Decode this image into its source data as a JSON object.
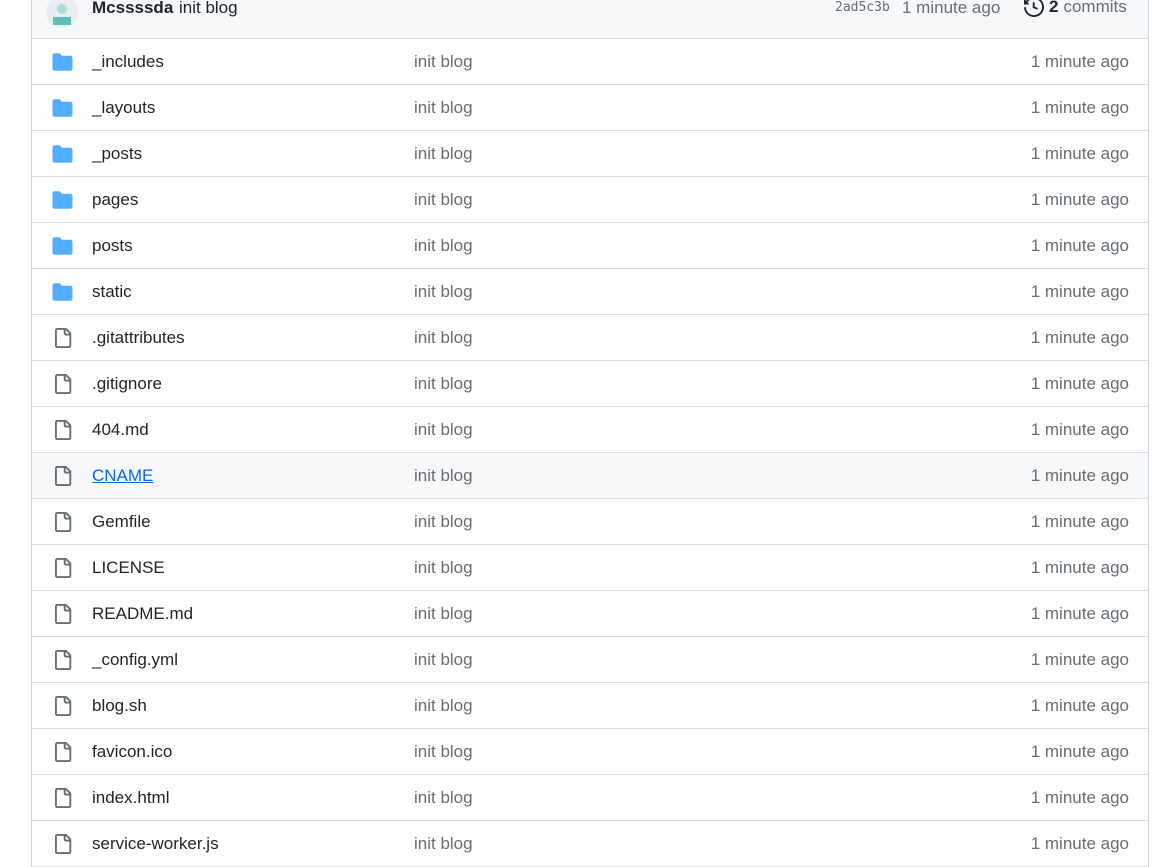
{
  "latest_commit": {
    "author": "Mcssssda",
    "message": "init blog",
    "sha": "2ad5c3b",
    "time": "1 minute ago",
    "commits_count": "2",
    "commits_label": "commits",
    "icon": "history-icon"
  },
  "files": [
    {
      "name": "_includes",
      "type": "folder",
      "message": "init blog",
      "age": "1 minute ago"
    },
    {
      "name": "_layouts",
      "type": "folder",
      "message": "init blog",
      "age": "1 minute ago"
    },
    {
      "name": "_posts",
      "type": "folder",
      "message": "init blog",
      "age": "1 minute ago"
    },
    {
      "name": "pages",
      "type": "folder",
      "message": "init blog",
      "age": "1 minute ago"
    },
    {
      "name": "posts",
      "type": "folder",
      "message": "init blog",
      "age": "1 minute ago"
    },
    {
      "name": "static",
      "type": "folder",
      "message": "init blog",
      "age": "1 minute ago"
    },
    {
      "name": ".gitattributes",
      "type": "file",
      "message": "init blog",
      "age": "1 minute ago"
    },
    {
      "name": ".gitignore",
      "type": "file",
      "message": "init blog",
      "age": "1 minute ago"
    },
    {
      "name": "404.md",
      "type": "file",
      "message": "init blog",
      "age": "1 minute ago"
    },
    {
      "name": "CNAME",
      "type": "file",
      "message": "init blog",
      "age": "1 minute ago",
      "hovered": true
    },
    {
      "name": "Gemfile",
      "type": "file",
      "message": "init blog",
      "age": "1 minute ago"
    },
    {
      "name": "LICENSE",
      "type": "file",
      "message": "init blog",
      "age": "1 minute ago"
    },
    {
      "name": "README.md",
      "type": "file",
      "message": "init blog",
      "age": "1 minute ago"
    },
    {
      "name": "_config.yml",
      "type": "file",
      "message": "init blog",
      "age": "1 minute ago"
    },
    {
      "name": "blog.sh",
      "type": "file",
      "message": "init blog",
      "age": "1 minute ago"
    },
    {
      "name": "favicon.ico",
      "type": "file",
      "message": "init blog",
      "age": "1 minute ago"
    },
    {
      "name": "index.html",
      "type": "file",
      "message": "init blog",
      "age": "1 minute ago"
    },
    {
      "name": "service-worker.js",
      "type": "file",
      "message": "init blog",
      "age": "1 minute ago"
    }
  ],
  "colors": {
    "folder": "#54aeff",
    "file_icon": "#656d76",
    "link": "#0969da",
    "muted_text": "#656d76",
    "border": "#d0d7de"
  }
}
